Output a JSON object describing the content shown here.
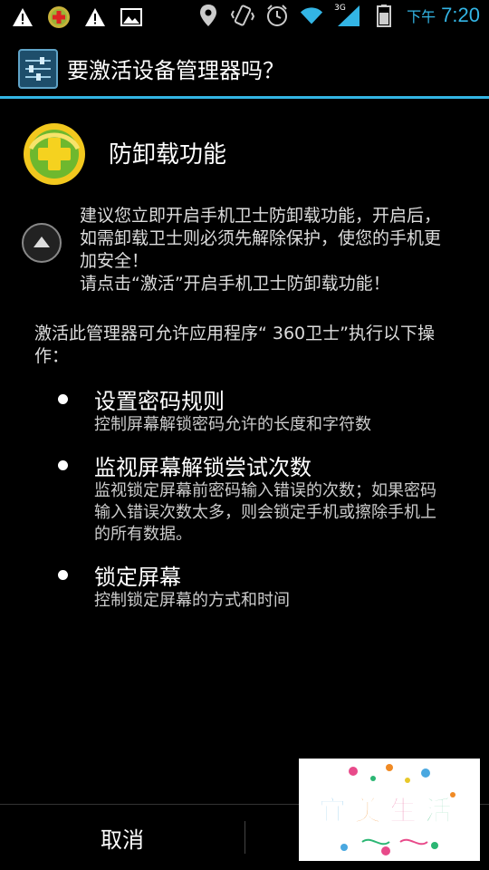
{
  "status_bar": {
    "left_icons": [
      "warning-icon",
      "app-360-icon",
      "warning-icon",
      "image-icon"
    ],
    "right_icons": [
      "location-icon",
      "vibrate-icon",
      "alarm-icon",
      "wifi-icon",
      "signal-icon",
      "battery-icon"
    ],
    "network_label": "3G",
    "time_ampm": "下午",
    "time": "7:20",
    "accent_color": "#33b5e5"
  },
  "dialog": {
    "title": "要激活设备管理器吗？"
  },
  "feature": {
    "title": "防卸载功能",
    "advice_line1": "建议您立即开启手机卫士防卸载功能，开启后，如需卸载卫士则必须先解除保护，使您的手机更加安全！",
    "advice_line2": "请点击“激活”开启手机卫士防卸载功能！"
  },
  "intro": "激活此管理器可允许应用程序“ 360卫士”执行以下操作：",
  "policies": [
    {
      "title": "设置密码规则",
      "desc": "控制屏幕解锁密码允许的长度和字符数"
    },
    {
      "title": "监视屏幕解锁尝试次数",
      "desc": "监视锁定屏幕前密码输入错误的次数；如果密码输入错误次数太多，则会锁定手机或擦除手机上的所有数据。"
    },
    {
      "title": "锁定屏幕",
      "desc": "控制锁定屏幕的方式和时间"
    }
  ],
  "buttons": {
    "cancel": "取消"
  },
  "watermark": {
    "text": "宜美生活",
    "colors": [
      "#4aa8e0",
      "#f08a24",
      "#e84a8a",
      "#2bb673"
    ]
  }
}
